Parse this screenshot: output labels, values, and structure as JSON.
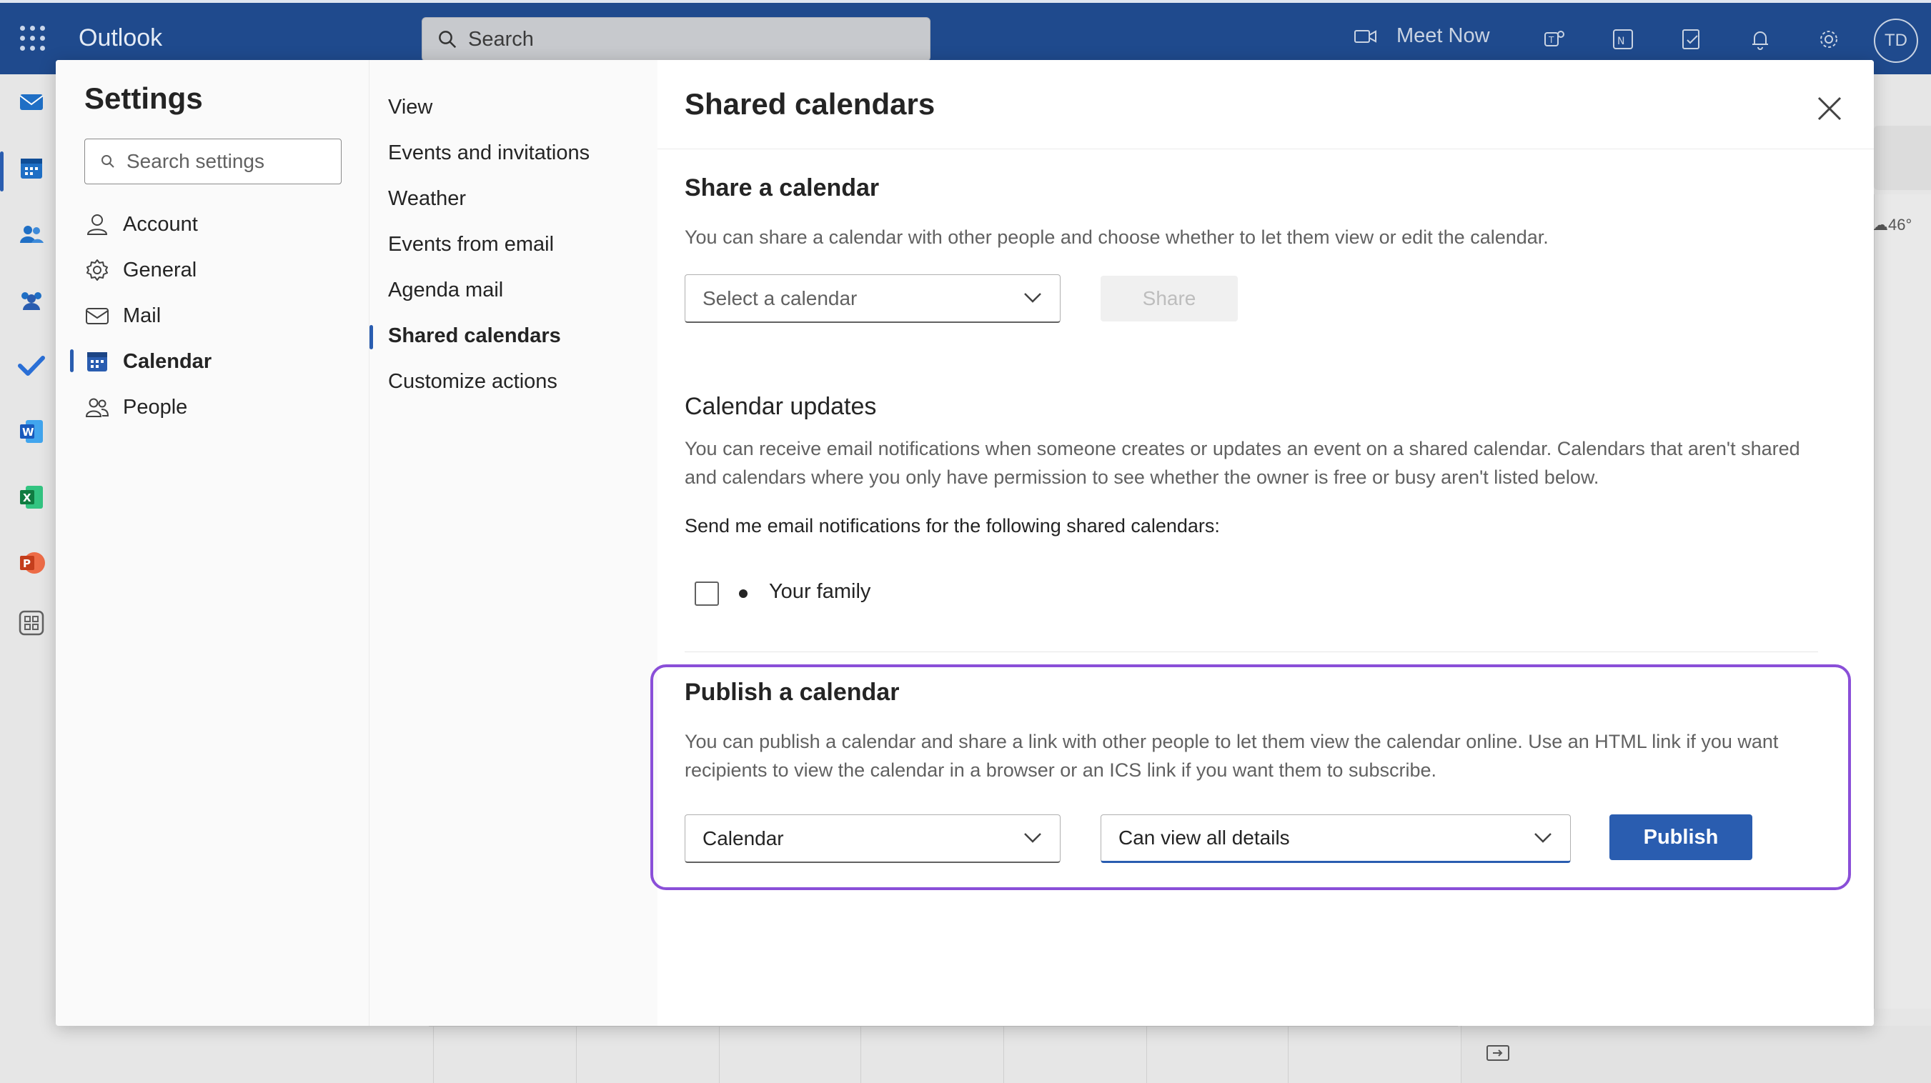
{
  "topbar": {
    "app_name": "Outlook",
    "search_placeholder": "Search",
    "meet_now": "Meet Now",
    "avatar_initials": "TD"
  },
  "background": {
    "weather_temp": "46°"
  },
  "settings": {
    "title": "Settings",
    "search_placeholder": "Search settings",
    "categories": [
      {
        "label": "Account",
        "icon": "person-icon"
      },
      {
        "label": "General",
        "icon": "gear-icon"
      },
      {
        "label": "Mail",
        "icon": "mail-icon"
      },
      {
        "label": "Calendar",
        "icon": "calendar-icon",
        "active": true
      },
      {
        "label": "People",
        "icon": "people-icon"
      }
    ],
    "subcategories": [
      {
        "label": "View"
      },
      {
        "label": "Events and invitations"
      },
      {
        "label": "Weather"
      },
      {
        "label": "Events from email"
      },
      {
        "label": "Agenda mail"
      },
      {
        "label": "Shared calendars",
        "active": true
      },
      {
        "label": "Customize actions"
      }
    ]
  },
  "content": {
    "title": "Shared calendars",
    "share": {
      "heading": "Share a calendar",
      "description": "You can share a calendar with other people and choose whether to let them view or edit the calendar.",
      "select_placeholder": "Select a calendar",
      "share_button": "Share"
    },
    "updates": {
      "heading": "Calendar updates",
      "description": "You can receive email notifications when someone creates or updates an event on a shared calendar. Calendars that aren't shared and calendars where you only have permission to see whether the owner is free or busy aren't listed below.",
      "notify_label": "Send me email notifications for the following shared calendars:",
      "calendars": [
        {
          "name": "Your family",
          "checked": false
        }
      ]
    },
    "publish": {
      "heading": "Publish a calendar",
      "description": "You can publish a calendar and share a link with other people to let them view the calendar online. Use an HTML link if you want recipients to view the calendar in a browser or an ICS link if you want them to subscribe.",
      "calendar_value": "Calendar",
      "permission_value": "Can view all details",
      "publish_button": "Publish"
    }
  },
  "colors": {
    "topbar": "#1f4a8d",
    "accent": "#2a5db0",
    "highlight": "#8a4fd8"
  }
}
